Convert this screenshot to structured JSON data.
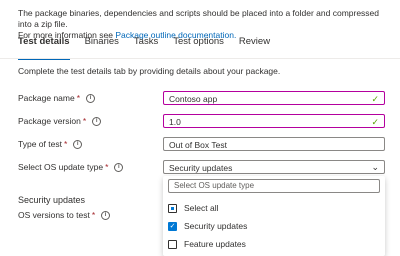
{
  "intro": {
    "line1": "The package binaries, dependencies and scripts should be placed into a folder and compressed into a zip file.",
    "line2_prefix": "For more information see ",
    "line2_link": "Package outline documentation."
  },
  "tabs": [
    {
      "label": "Test details",
      "active": true
    },
    {
      "label": "Binaries",
      "active": false
    },
    {
      "label": "Tasks",
      "active": false
    },
    {
      "label": "Test options",
      "active": false
    },
    {
      "label": "Review",
      "active": false
    }
  ],
  "description": "Complete the test details tab by providing details about your package.",
  "form": {
    "package_name": {
      "label": "Package name",
      "value": "Contoso app"
    },
    "package_version": {
      "label": "Package version",
      "value": "1.0"
    },
    "test_type": {
      "label": "Type of test",
      "value": "Out of Box Test"
    },
    "os_update_type": {
      "label": "Select OS update type",
      "value": "Security updates"
    }
  },
  "section_title": "Security updates",
  "os_versions": {
    "label": "OS versions to test"
  },
  "required_marker": "*",
  "info_glyph": "i",
  "dropdown": {
    "search_placeholder": "Select OS update type",
    "options": [
      {
        "label": "Select all",
        "state": "partial"
      },
      {
        "label": "Security updates",
        "state": "checked"
      },
      {
        "label": "Feature updates",
        "state": "unchecked"
      }
    ]
  },
  "colors": {
    "accent": "#0067b8",
    "valid_border": "#b4009e",
    "valid_check": "#57a300",
    "required": "#a4262c"
  }
}
